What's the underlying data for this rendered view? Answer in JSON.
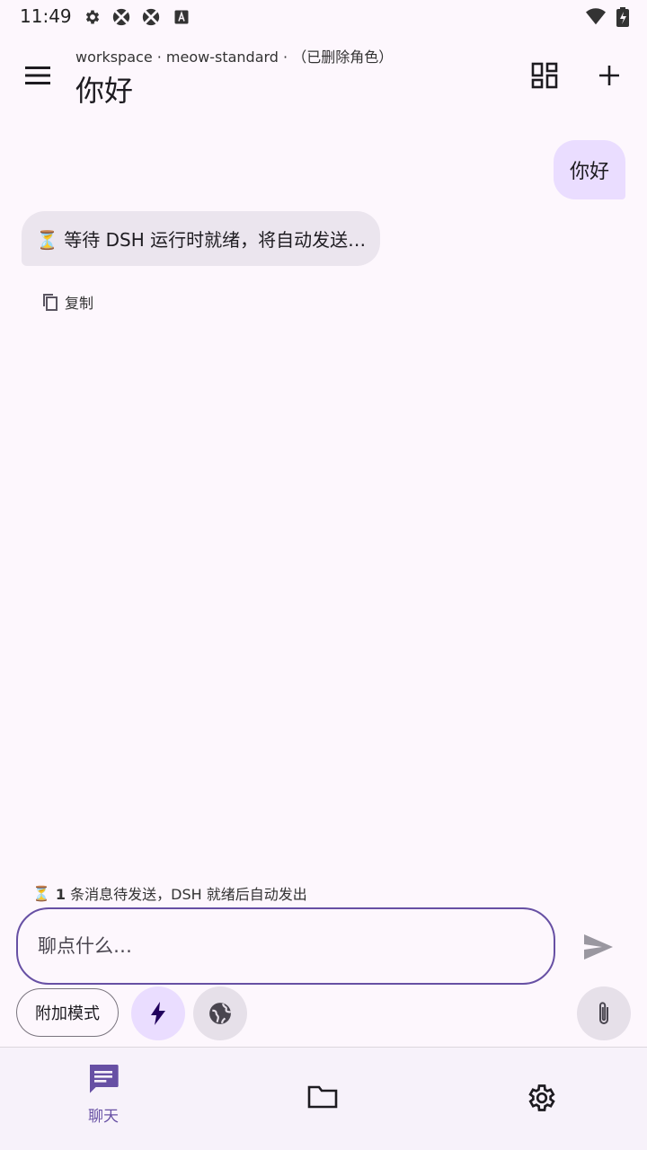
{
  "status_bar": {
    "time": "11:49",
    "icons": [
      "gear-icon",
      "app-icon",
      "app-icon",
      "a-icon",
      "wifi-icon",
      "battery-icon"
    ]
  },
  "header": {
    "subtitle": "workspace · meow-standard · （已删除角色）",
    "title": "你好",
    "menu_icon": "hamburger-menu-icon",
    "actions": [
      "dashboard-icon",
      "add-icon"
    ]
  },
  "messages": [
    {
      "role": "user",
      "text": "你好"
    },
    {
      "role": "assistant",
      "text": "⏳ 等待 DSH 运行时就绪，将自动发送…"
    }
  ],
  "message_actions": {
    "copy_label": "复制"
  },
  "pending_notice": {
    "icon": "⏳",
    "count": "1",
    "text": " 条消息待发送，DSH 就绪后自动发出"
  },
  "composer": {
    "placeholder": "聊点什么…",
    "value": "",
    "attach_mode_label": "附加模式",
    "buttons": [
      "bolt-icon",
      "globe-icon",
      "attach-icon",
      "send-icon"
    ]
  },
  "bottom_nav": {
    "items": [
      {
        "label": "聊天",
        "icon": "chat-icon",
        "active": true
      },
      {
        "label": "",
        "icon": "folder-icon",
        "active": false
      },
      {
        "label": "",
        "icon": "settings-icon",
        "active": false
      }
    ]
  },
  "colors": {
    "background": "#fdf7fd",
    "primary": "#6750a4",
    "user_bubble": "#eaddff",
    "assistant_bubble": "#ebe5ee",
    "nav_background": "#f7f2fa"
  }
}
